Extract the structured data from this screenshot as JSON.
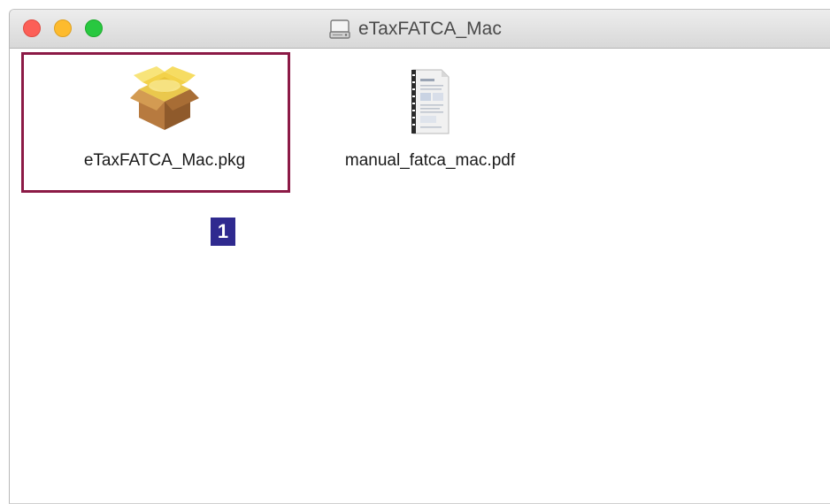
{
  "window": {
    "title": "eTaxFATCA_Mac",
    "title_icon": "disk-icon",
    "controls": {
      "close": "close-button",
      "minimize": "minimize-button",
      "zoom": "zoom-button"
    }
  },
  "files": [
    {
      "name": "eTaxFATCA_Mac.pkg",
      "icon": "package-icon"
    },
    {
      "name": "manual_fatca_mac.pdf",
      "icon": "pdf-document-icon"
    }
  ],
  "annotation": {
    "step_number": "1",
    "highlight_color": "#8c1a46",
    "badge_color": "#2f2a8f"
  }
}
